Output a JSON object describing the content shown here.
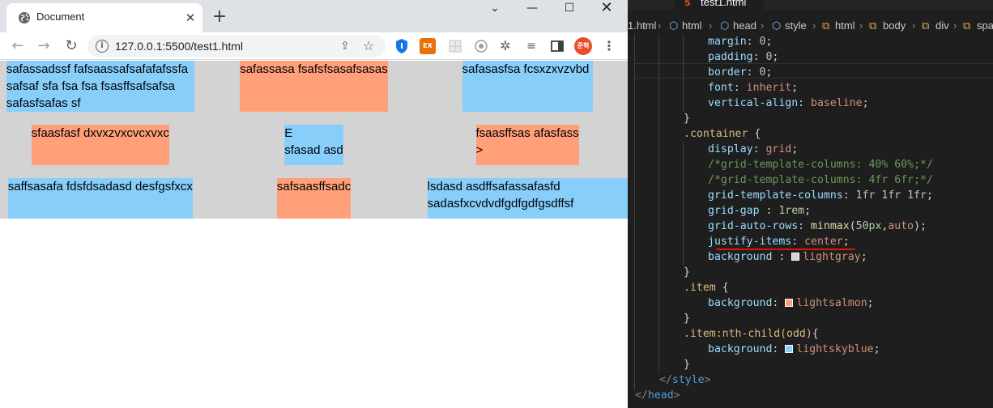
{
  "browser": {
    "tab_title": "Document",
    "tab_close": "✕",
    "new_tab": "+",
    "window_controls": {
      "chevron": "⌄",
      "minimize": "—",
      "maximize": "☐",
      "close": "✕"
    },
    "nav": {
      "back": "←",
      "forward": "→",
      "reload": "↻"
    },
    "url": "127.0.0.1:5500/test1.html",
    "info_icon": "i",
    "share_icon": "⇪",
    "bookmark_icon": "☆",
    "ext_translate": "EX",
    "ext_puzzle": "✲",
    "ext_media": "≡",
    "profile_label": "준혁",
    "menu_icon": "⋮"
  },
  "page": {
    "items": [
      {
        "text": "safassadssf fafsaassafsafafafssfa safsaf sfa fsa fsa fsasffsafsafsa safasfsafas sf"
      },
      {
        "text": "safassasa fsafsfsasafsasas"
      },
      {
        "text": "safasasfsa fcsxzxvzvbd"
      },
      {
        "text": "sfaasfasf dxvxzvxcvcxvxc"
      },
      {
        "text": "E\nsfasad asd"
      },
      {
        "text": "fsaasffsas afasfass\n>"
      },
      {
        "text": "saffsasafa fdsfdsadasd desfgsfxcx"
      },
      {
        "text": "safsaasffsadc"
      },
      {
        "text": "lsdasd asdffsafassafasfd sadasfxcvdvdfgdfgdfgsdffsf"
      }
    ]
  },
  "editor": {
    "tab_title": "test1.html",
    "tab_icon": "5",
    "breadcrumb": [
      "1.html",
      "html",
      "head",
      "style",
      "html",
      "body",
      "div",
      "spa"
    ],
    "colors": {
      "lightgray": "#d3d3d3",
      "lightsalmon": "#ffa07a",
      "lightskyblue": "#87cefa",
      "underline": "#e51400"
    },
    "code": {
      "l1_prop": "margin",
      "l1_val": "0",
      "l2_prop": "padding",
      "l2_val": "0",
      "l3_prop": "border",
      "l3_val": "0",
      "l4_prop": "font",
      "l4_val": "inherit",
      "l5_prop": "vertical-align",
      "l5_val": "baseline",
      "l6": "}",
      "l7_sel": ".container",
      "l7_brace": "{",
      "l8_prop": "display",
      "l8_val": "grid",
      "l9_cmt": "/*grid-template-columns: 40% 60%;*/",
      "l10_cmt": "/*grid-template-columns: 4fr 6fr;*/",
      "l11_prop": "grid-template-columns",
      "l11_val": "1fr 1fr 1fr",
      "l12_prop": "grid-gap ",
      "l12_val": "1rem",
      "l13_prop": "grid-auto-rows",
      "l13_fn": "minmax",
      "l13_a": "50px",
      "l13_b": "auto",
      "l14_prop": "justify-items",
      "l14_val": "center",
      "l15_prop": "background ",
      "l15_val": "lightgray",
      "l16": "}",
      "l17_sel": ".item",
      "l17_brace": "{",
      "l18_prop": "background",
      "l18_val": "lightsalmon",
      "l19": "}",
      "l20_sel": ".item:nth-child(odd)",
      "l20_brace": "{",
      "l21_prop": "background",
      "l21_val": "lightskyblue",
      "l22": "}",
      "l23_tag": "style",
      "l24_tag": "head"
    }
  }
}
